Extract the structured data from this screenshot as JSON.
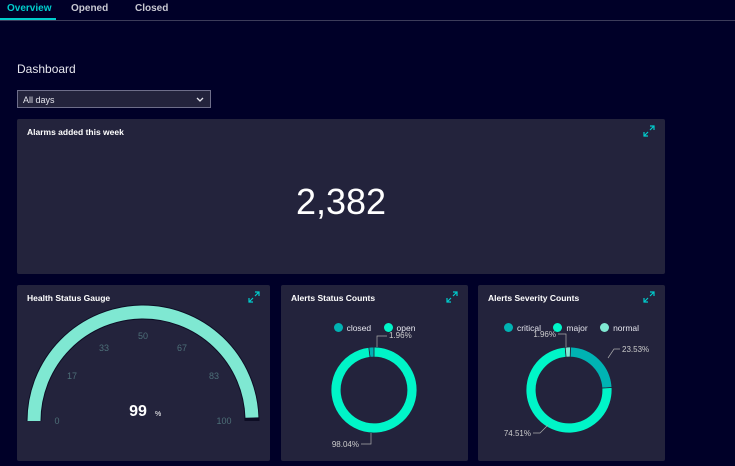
{
  "tabs": [
    {
      "label": "Overview",
      "active": true
    },
    {
      "label": "Opened",
      "active": false
    },
    {
      "label": "Closed",
      "active": false
    }
  ],
  "page_title": "Dashboard",
  "filter": {
    "selected": "All days"
  },
  "alarms_card": {
    "title": "Alarms added this week",
    "value": "2,382"
  },
  "gauge_card": {
    "title": "Health Status Gauge",
    "value": "99",
    "unit": "%",
    "ticks": [
      "0",
      "17",
      "33",
      "50",
      "67",
      "83",
      "100"
    ]
  },
  "status_card": {
    "title": "Alerts Status Counts",
    "legend": [
      {
        "label": "closed",
        "color": "#00b3b3"
      },
      {
        "label": "open",
        "color": "#00f5c8"
      }
    ],
    "labels": {
      "small": "1.96%",
      "large": "98.04%"
    }
  },
  "severity_card": {
    "title": "Alerts Severity Counts",
    "legend": [
      {
        "label": "critical",
        "color": "#00b3b3"
      },
      {
        "label": "major",
        "color": "#00f5c8"
      },
      {
        "label": "normal",
        "color": "#7fe8d2"
      }
    ],
    "labels": {
      "small": "1.96%",
      "medium": "23.53%",
      "large": "74.51%"
    }
  },
  "chart_data": [
    {
      "type": "pie",
      "title": "Alerts Status Counts",
      "categories": [
        "closed",
        "open"
      ],
      "values": [
        1.96,
        98.04
      ],
      "colors": [
        "#00b3b3",
        "#00f5c8"
      ],
      "legend": "top"
    },
    {
      "type": "pie",
      "title": "Alerts Severity Counts",
      "categories": [
        "critical",
        "major",
        "normal"
      ],
      "values": [
        23.53,
        74.51,
        1.96
      ],
      "colors": [
        "#00b3b3",
        "#00f5c8",
        "#7fe8d2"
      ],
      "legend": "top"
    }
  ],
  "gauge_level_percent": 99,
  "icons": {
    "expand": "expand-icon",
    "chevron": "chevron-down-icon"
  }
}
